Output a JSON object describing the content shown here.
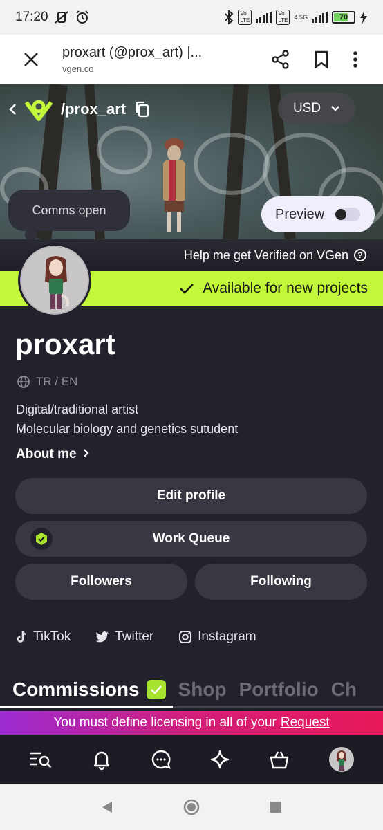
{
  "status_bar": {
    "time": "17:20",
    "battery": "70",
    "network": "4.5G"
  },
  "browser": {
    "title": "proxart (@prox_art) |...",
    "url": "vgen.co"
  },
  "header": {
    "slug": "/prox_art",
    "currency": "USD"
  },
  "profile": {
    "comms_bubble": "Comms open",
    "preview_label": "Preview",
    "verify_text": "Help me get Verified on VGen",
    "available_text": "Available for new projects",
    "name": "proxart",
    "languages": "TR / EN",
    "bio_line1": "Digital/traditional artist",
    "bio_line2": "Molecular biology and genetics sutudent",
    "about_label": "About me"
  },
  "buttons": {
    "edit_profile": "Edit profile",
    "work_queue": "Work Queue",
    "followers": "Followers",
    "following": "Following"
  },
  "socials": [
    {
      "label": "TikTok",
      "icon": "tiktok-icon"
    },
    {
      "label": "Twitter",
      "icon": "twitter-icon"
    },
    {
      "label": "Instagram",
      "icon": "instagram-icon"
    }
  ],
  "tabs": [
    "Commissions",
    "Shop",
    "Portfolio",
    "Ch"
  ],
  "notice": {
    "text": "You must define licensing in all of your",
    "link": "Request"
  },
  "colors": {
    "accent": "#c3f73a",
    "background": "#22222c",
    "button": "#383842",
    "notice_start": "#9c2bd2",
    "notice_end": "#e81a5a"
  }
}
